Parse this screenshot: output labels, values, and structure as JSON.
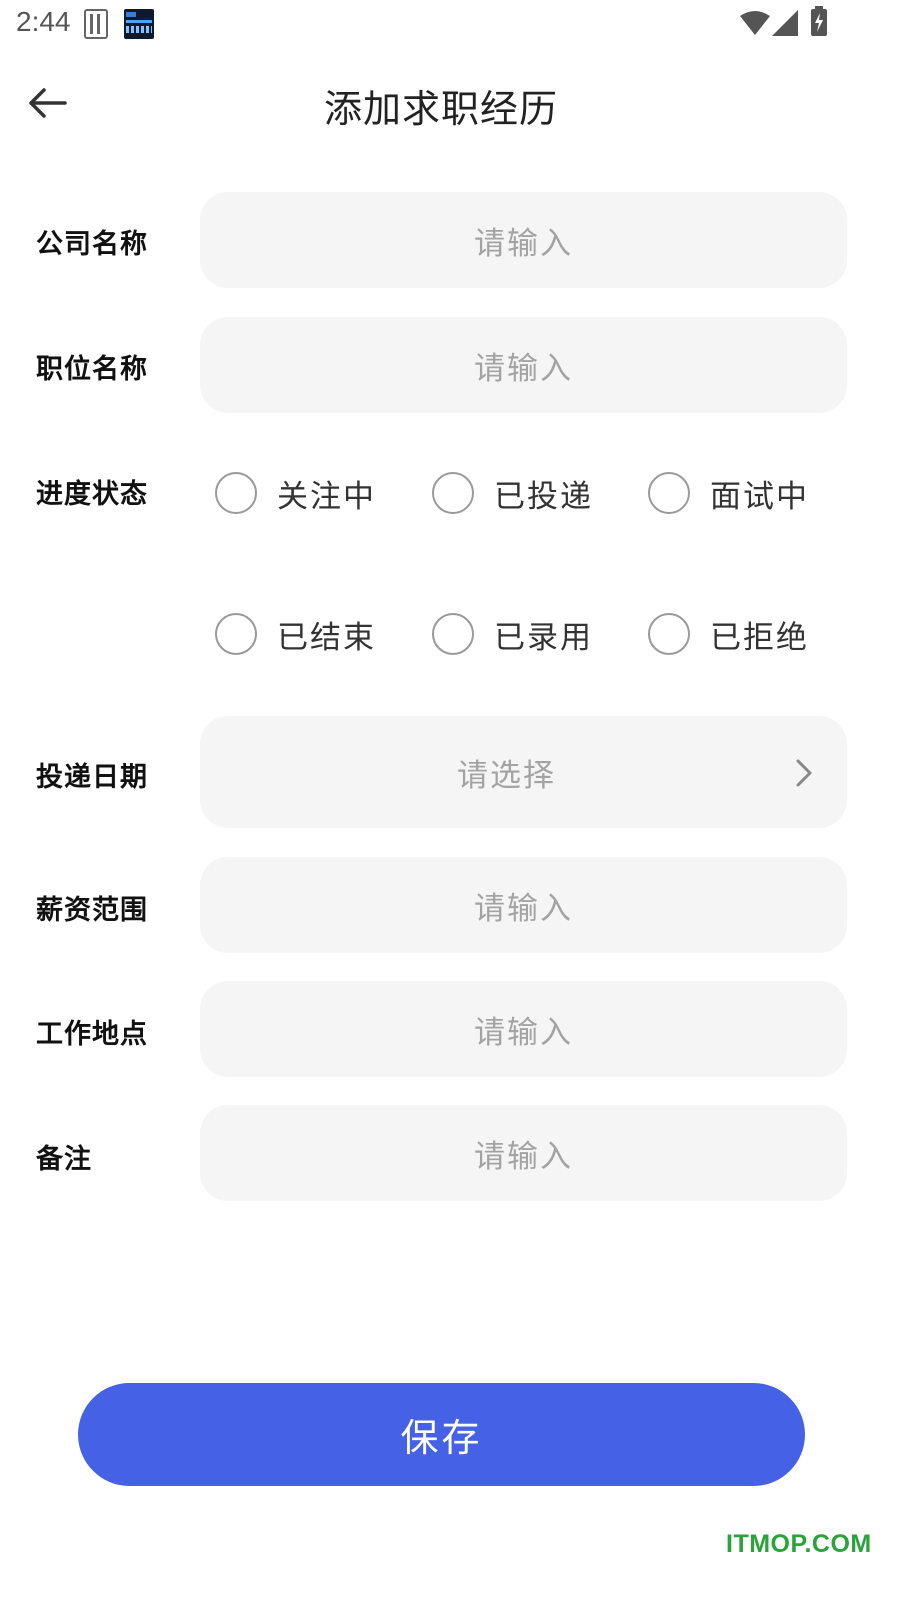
{
  "status_bar": {
    "time": "2:44",
    "icons": [
      "sim-card-icon",
      "clock-widget-icon",
      "wifi-icon",
      "signal-icon",
      "battery-charging-icon"
    ]
  },
  "header": {
    "title": "添加求职经历",
    "back_icon": "arrow-left-icon"
  },
  "form": {
    "company": {
      "label": "公司名称",
      "placeholder": "请输入"
    },
    "position": {
      "label": "职位名称",
      "placeholder": "请输入"
    },
    "progress": {
      "label": "进度状态",
      "options": [
        "关注中",
        "已投递",
        "面试中",
        "已结束",
        "已录用",
        "已拒绝"
      ],
      "selected": null
    },
    "apply_date": {
      "label": "投递日期",
      "placeholder": "请选择",
      "icon": "chevron-right-icon"
    },
    "salary": {
      "label": "薪资范围",
      "placeholder": "请输入"
    },
    "location": {
      "label": "工作地点",
      "placeholder": "请输入"
    },
    "notes": {
      "label": "备注",
      "placeholder": "请输入"
    }
  },
  "save_button": {
    "label": "保存"
  },
  "watermark": "ITMOP.COM",
  "colors": {
    "primary": "#4561e5",
    "input_background": "#f5f5f5",
    "placeholder": "#a3a3a3",
    "watermark": "#2aa33a"
  }
}
